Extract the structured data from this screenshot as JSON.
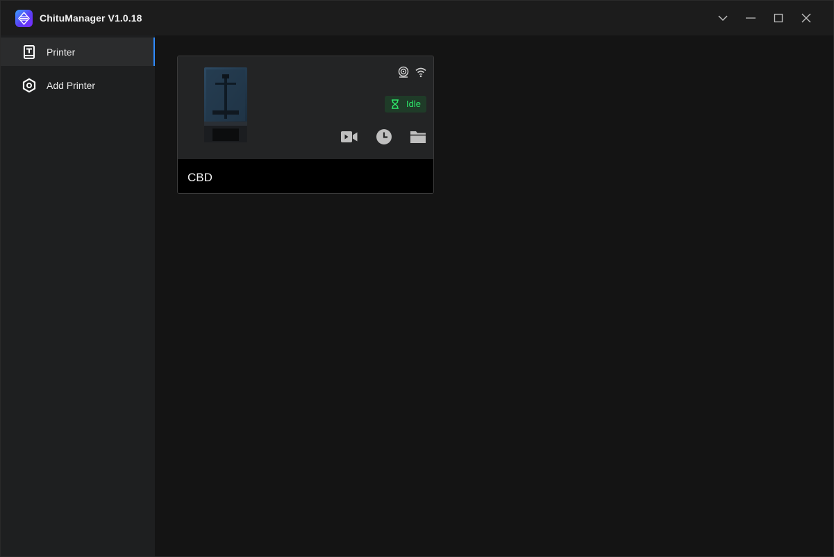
{
  "app": {
    "title": "ChituManager V1.0.18"
  },
  "window_controls": {
    "dropdown": "chevron-down-icon",
    "minimize": "minimize-icon",
    "maximize": "maximize-icon",
    "close": "close-icon"
  },
  "sidebar": {
    "items": [
      {
        "label": "Printer",
        "icon": "printer-icon",
        "active": true
      },
      {
        "label": "Add Printer",
        "icon": "hexagon-add-icon",
        "active": false
      }
    ]
  },
  "printer_card": {
    "name": "CBD",
    "status": "Idle",
    "connection_icons": [
      "camera-lens-icon",
      "wifi-icon"
    ],
    "actions": [
      "video-icon",
      "history-clock-icon",
      "folder-icon"
    ]
  },
  "colors": {
    "accent": "#2f8bff",
    "status_idle": "#2ee86b",
    "status_badge_bg": "#1f3b28",
    "background": "#141414",
    "sidebar": "#1e1f20"
  }
}
